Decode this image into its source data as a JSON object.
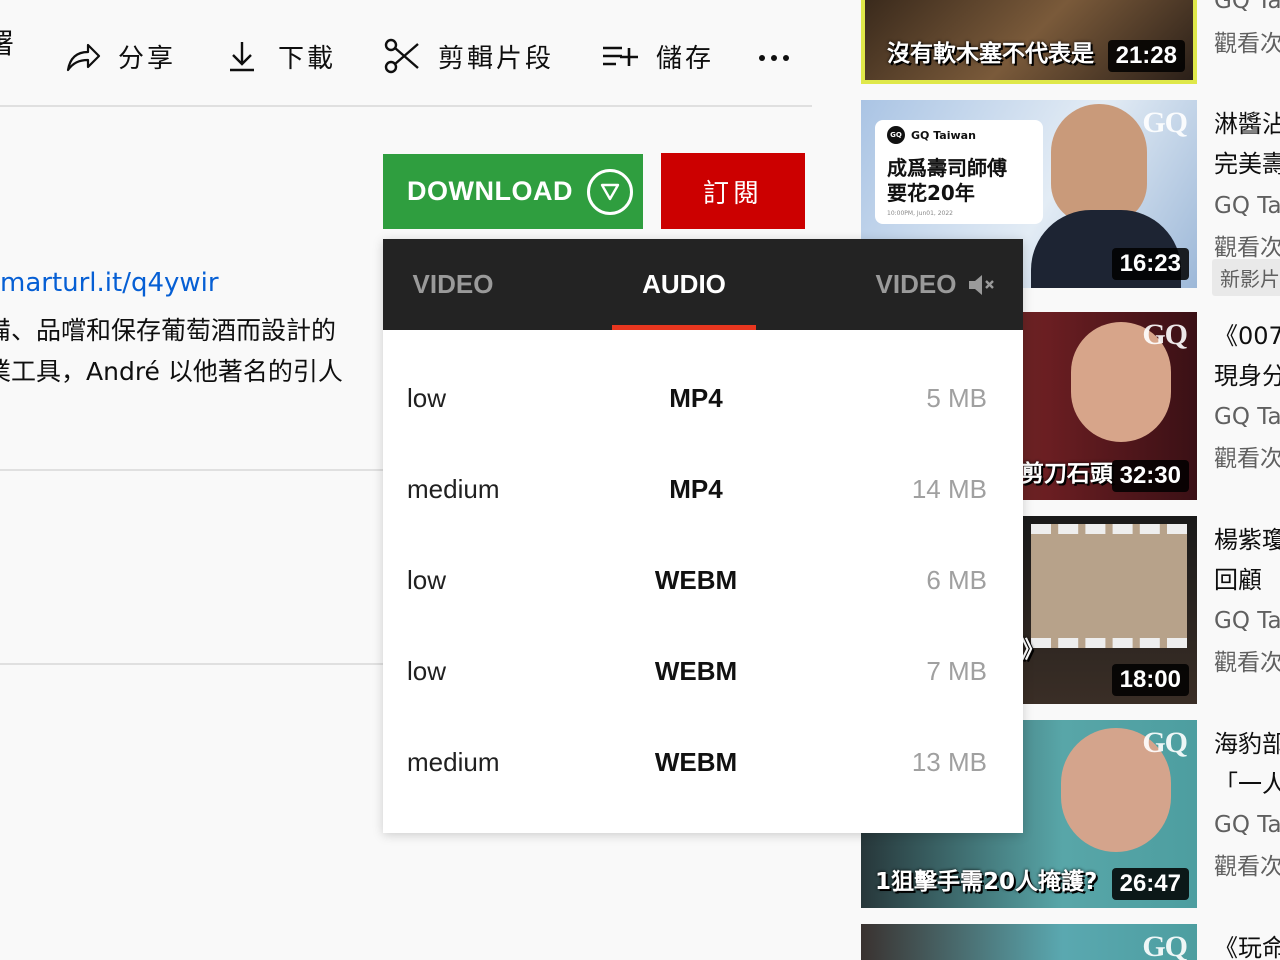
{
  "page": {
    "cut_title_char": "署"
  },
  "actions": {
    "share": {
      "label": "分享",
      "icon": "share-icon"
    },
    "download": {
      "label": "下載",
      "icon": "download-icon"
    },
    "clip": {
      "label": "剪輯片段",
      "icon": "scissors-icon"
    },
    "save": {
      "label": "儲存",
      "icon": "playlist-add-icon"
    },
    "more": {
      "icon": "more-horizontal-icon"
    }
  },
  "download_button": {
    "label": "DOWNLOAD",
    "icon": "chevron-down-circle-icon",
    "color": "#2f9e3f"
  },
  "subscribe_button": {
    "label": "訂閱",
    "color": "#cc0000"
  },
  "description": {
    "link": "marturl.it/q4ywir",
    "line1": "備、品嚐和保存葡萄酒而設計的",
    "line2": "業工具，André 以他著名的引人"
  },
  "dropdown": {
    "accent": "#e8361f",
    "tabs": [
      {
        "label": "VIDEO",
        "active": false
      },
      {
        "label": "AUDIO",
        "active": true
      },
      {
        "label": "VIDEO",
        "active": false,
        "icon": "mute-icon"
      }
    ],
    "rows": [
      {
        "quality": "low",
        "format": "MP4",
        "size": "5 MB"
      },
      {
        "quality": "medium",
        "format": "MP4",
        "size": "14 MB"
      },
      {
        "quality": "low",
        "format": "WEBM",
        "size": "6 MB"
      },
      {
        "quality": "low",
        "format": "WEBM",
        "size": "7 MB"
      },
      {
        "quality": "medium",
        "format": "WEBM",
        "size": "13 MB"
      }
    ]
  },
  "sidebar": {
    "videos": [
      {
        "overlay": "沒有軟木塞不代表是",
        "duration": "21:28",
        "title": "",
        "title2": "",
        "channel": "GQ Tai",
        "views": "觀看次"
      },
      {
        "overlay": "",
        "duration": "16:23",
        "title": "淋醬沾",
        "title2": "完美壽",
        "channel": "GQ Tai",
        "views": "觀看次",
        "badge": "新影片",
        "card": {
          "channel": "GQ Taiwan",
          "logo": "GQ",
          "headline1": "成爲壽司師傅",
          "headline2": "要花20年",
          "stamp": "10:00PM, Jun01, 2022"
        }
      },
      {
        "overlay": "剪刀石頭",
        "duration": "32:30",
        "title": "《007",
        "title2": "現身分",
        "channel": "GQ Tai",
        "views": "觀看次"
      },
      {
        "overlay": "》",
        "duration": "18:00",
        "title": "楊紫瓊",
        "title2": "回顧",
        "channel": "GQ Tai",
        "views": "觀看次"
      },
      {
        "overlay": "1狙擊手需20人掩護?",
        "duration": "26:47",
        "title": "海豹部",
        "title2": "「一人",
        "channel": "GQ Tai",
        "views": "觀看次"
      },
      {
        "overlay": "",
        "duration": "",
        "title": "《玩命",
        "title2": "",
        "channel": "",
        "views": ""
      }
    ],
    "watermark": "GQ"
  }
}
